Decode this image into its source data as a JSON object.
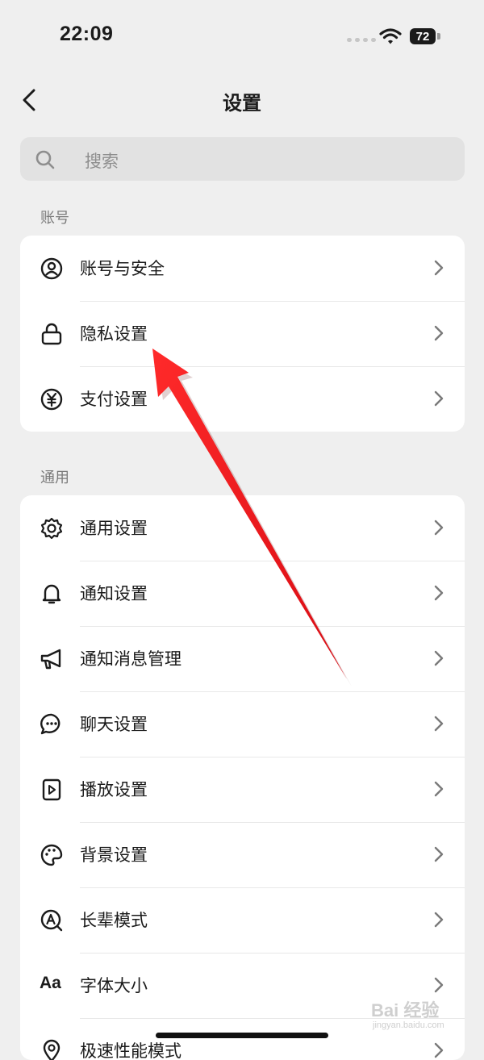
{
  "status_bar": {
    "time": "22:09",
    "battery": "72"
  },
  "header": {
    "title": "设置"
  },
  "search": {
    "placeholder": "搜索"
  },
  "sections": {
    "account": {
      "label": "账号",
      "items": [
        {
          "label": "账号与安全",
          "icon": "account-icon"
        },
        {
          "label": "隐私设置",
          "icon": "lock-icon"
        },
        {
          "label": "支付设置",
          "icon": "yen-icon"
        }
      ]
    },
    "general": {
      "label": "通用",
      "items": [
        {
          "label": "通用设置",
          "icon": "gear-icon"
        },
        {
          "label": "通知设置",
          "icon": "bell-icon"
        },
        {
          "label": "通知消息管理",
          "icon": "megaphone-icon"
        },
        {
          "label": "聊天设置",
          "icon": "chat-icon"
        },
        {
          "label": "播放设置",
          "icon": "play-icon"
        },
        {
          "label": "背景设置",
          "icon": "palette-icon"
        },
        {
          "label": "长辈模式",
          "icon": "elder-icon"
        },
        {
          "label": "字体大小",
          "icon": "font-size-icon",
          "glyph": "Aa"
        },
        {
          "label": "极速性能模式",
          "icon": "location-icon"
        }
      ]
    }
  },
  "watermark": {
    "brand": "Bai 经验",
    "url": "jingyan.baidu.com"
  },
  "colors": {
    "background": "#efefef",
    "card": "#ffffff",
    "arrow": "#e8141c"
  }
}
